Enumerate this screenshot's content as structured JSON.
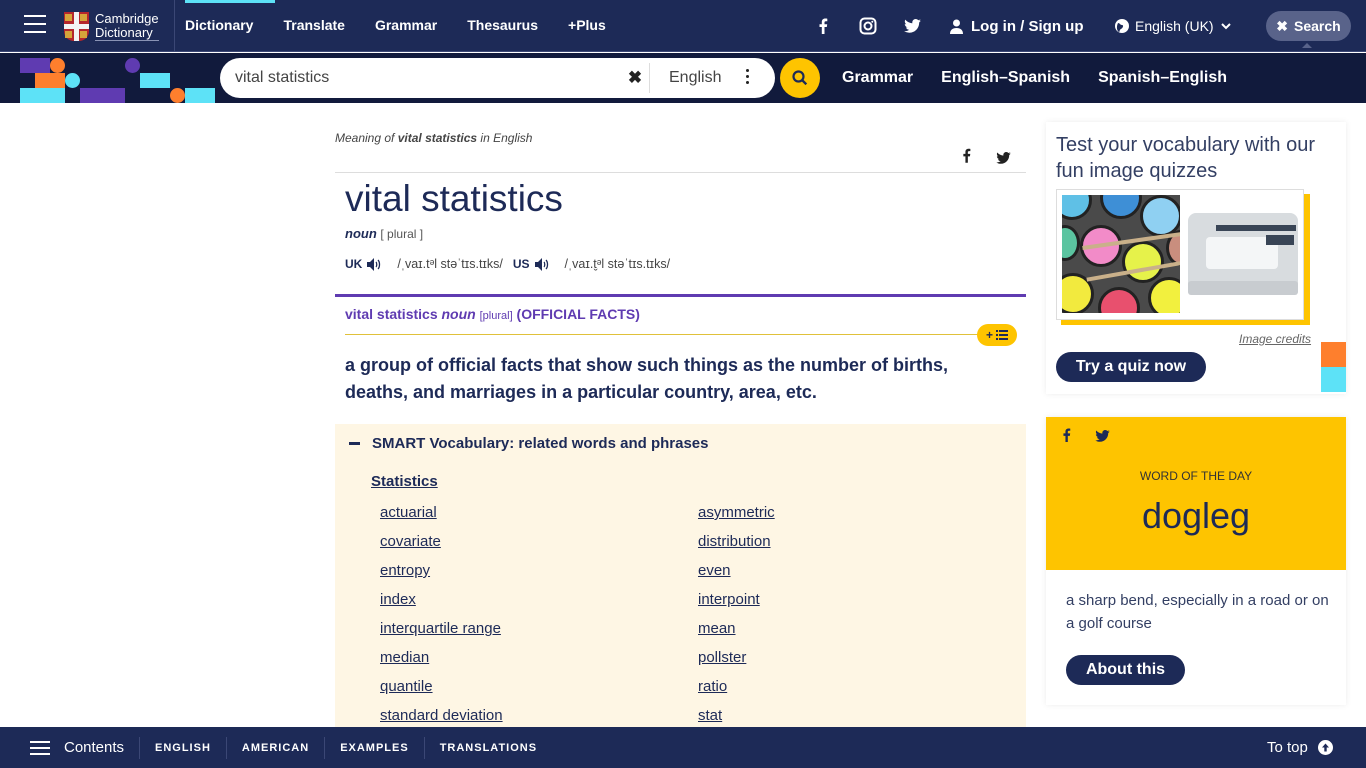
{
  "header": {
    "logo_line1": "Cambridge",
    "logo_line2": "Dictionary",
    "nav": [
      "Dictionary",
      "Translate",
      "Grammar",
      "Thesaurus",
      "+Plus"
    ],
    "login_label": "Log in / Sign up",
    "language_label": "English (UK)",
    "search_toggle_label": "Search"
  },
  "searchbar": {
    "query": "vital statistics",
    "dictionary": "English",
    "quick_links": [
      "Grammar",
      "English–Spanish",
      "Spanish–English"
    ]
  },
  "entry": {
    "meaning_prefix": "Meaning of ",
    "meaning_word": "vital statistics",
    "meaning_suffix": " in English",
    "headword": "vital statistics",
    "pos": "noun",
    "grammar": "[ plural ]",
    "pron_uk_label": "UK",
    "pron_uk": "/ˌvaɪ.tᵊl stəˈtɪs.tɪks/",
    "pron_us_label": "US",
    "pron_us": "/ˌvaɪ.t̬ᵊl stəˈtɪs.tɪks/",
    "sense": {
      "word": "vital statistics",
      "pos": "noun",
      "grammar": "[plural]",
      "guideword": "(OFFICIAL FACTS)",
      "definition": "a group of official facts that show such things as the number of births, deaths, and marriages in a particular country, area, etc."
    },
    "smart_vocab": {
      "title": "SMART Vocabulary: related words and phrases",
      "topic": "Statistics",
      "words": [
        "actuarial",
        "asymmetric",
        "covariate",
        "distribution",
        "entropy",
        "even",
        "index",
        "interpoint",
        "interquartile range",
        "mean",
        "median",
        "pollster",
        "quantile",
        "ratio",
        "standard deviation",
        "stat"
      ]
    }
  },
  "quiz": {
    "title": "Test your vocabulary with our fun image quizzes",
    "credits": "Image credits",
    "button": "Try a quiz now"
  },
  "word_of_day": {
    "label": "WORD OF THE DAY",
    "word": "dogleg",
    "definition": "a sharp bend, especially in a road or on a golf course",
    "button": "About this"
  },
  "bottombar": {
    "contents_label": "Contents",
    "links": [
      "ENGLISH",
      "AMERICAN",
      "EXAMPLES",
      "TRANSLATIONS"
    ],
    "totop_label": "To top"
  },
  "colors": {
    "brand_navy": "#1d2a57",
    "accent_yellow": "#fec400",
    "accent_purple": "#5f3bb1",
    "accent_cyan": "#5de2f7",
    "accent_orange": "#fe7f2d",
    "smart_bg": "#fef6e4"
  }
}
